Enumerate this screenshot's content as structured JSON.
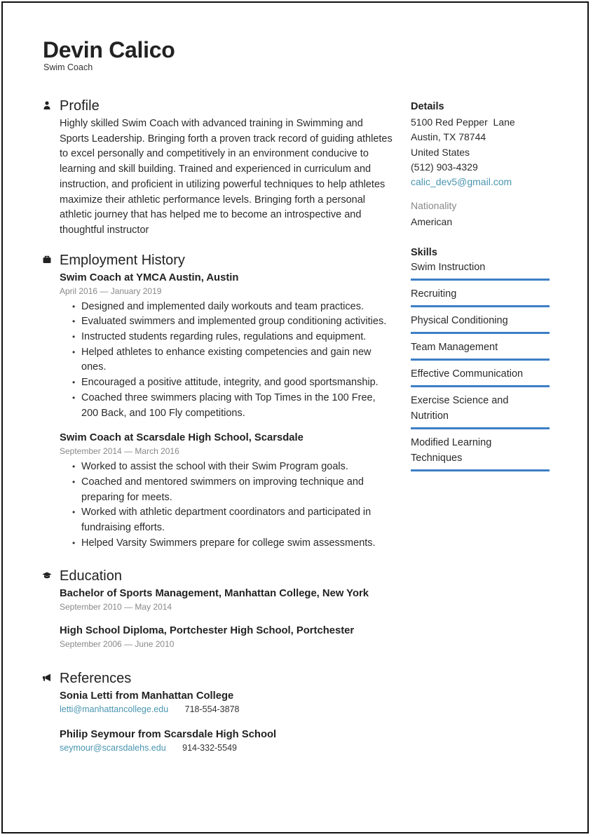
{
  "header": {
    "name": "Devin Calico",
    "title": "Swim Coach"
  },
  "profile": {
    "heading": "Profile",
    "icon": "person-icon",
    "text": "Highly skilled Swim Coach with advanced training in Swimming and Sports Leadership. Bringing forth a proven track record of guiding athletes to excel personally and competitively in an environment conducive to learning and skill building. Trained and experienced in curriculum and instruction, and proficient in utilizing powerful techniques to help athletes maximize their athletic performance levels. Bringing forth a personal athletic journey that has helped me to become an introspective  and thoughtful instructor"
  },
  "employment": {
    "heading": "Employment History",
    "icon": "briefcase-icon",
    "jobs": [
      {
        "title": "Swim Coach at YMCA Austin, Austin",
        "dates": "April 2016 — January 2019",
        "bullets": [
          "Designed and implemented daily workouts and team practices.",
          "Evaluated swimmers and implemented group conditioning activities.",
          "Instructed students regarding rules, regulations and equipment.",
          "Helped athletes to enhance existing competencies and gain new ones.",
          "Encouraged a positive attitude, integrity, and good sportsmanship.",
          "Coached three swimmers placing with Top Times in the 100 Free, 200 Back, and 100 Fly competitions."
        ]
      },
      {
        "title": "Swim Coach at Scarsdale High School, Scarsdale",
        "dates": "September 2014 — March 2016",
        "bullets": [
          "Worked to assist the school with their Swim Program goals.",
          "Coached and mentored swimmers on improving technique and preparing for meets.",
          "Worked with athletic department coordinators and participated in fundraising efforts.",
          "Helped Varsity Swimmers prepare for college swim assessments."
        ]
      }
    ]
  },
  "education": {
    "heading": "Education",
    "icon": "graduation-cap-icon",
    "items": [
      {
        "title": "Bachelor of Sports Management, Manhattan College, New York",
        "dates": "September 2010 — May 2014"
      },
      {
        "title": "High School Diploma, Portchester High School, Portchester",
        "dates": "September 2006 — June 2010"
      }
    ]
  },
  "references": {
    "heading": "References",
    "icon": "megaphone-icon",
    "items": [
      {
        "name": "Sonia Letti from Manhattan College",
        "email": "letti@manhattancollege.edu",
        "phone": "718-554-3878"
      },
      {
        "name": "Philip Seymour from Scarsdale High School",
        "email": "seymour@scarsdalehs.edu",
        "phone": "914-332-5549"
      }
    ]
  },
  "details": {
    "heading": "Details",
    "address_line1": "5100 Red Pepper  Lane",
    "address_line2": "Austin, TX 78744",
    "country": "United States",
    "phone": "(512) 903-4329",
    "email": "calic_dev5@gmail.com",
    "nationality_label": "Nationality",
    "nationality": "American"
  },
  "skills": {
    "heading": "Skills",
    "accent_color": "#3d7fc6",
    "items": [
      {
        "name": "Swim Instruction",
        "level": 1.0
      },
      {
        "name": "Recruiting",
        "level": 1.0
      },
      {
        "name": "Physical Conditioning",
        "level": 1.0
      },
      {
        "name": "Team Management",
        "level": 1.0
      },
      {
        "name": "Effective Communication",
        "level": 1.0
      },
      {
        "name": "Exercise Science and Nutrition",
        "level": 1.0
      },
      {
        "name": "Modified Learning Techniques",
        "level": 1.0
      }
    ]
  }
}
